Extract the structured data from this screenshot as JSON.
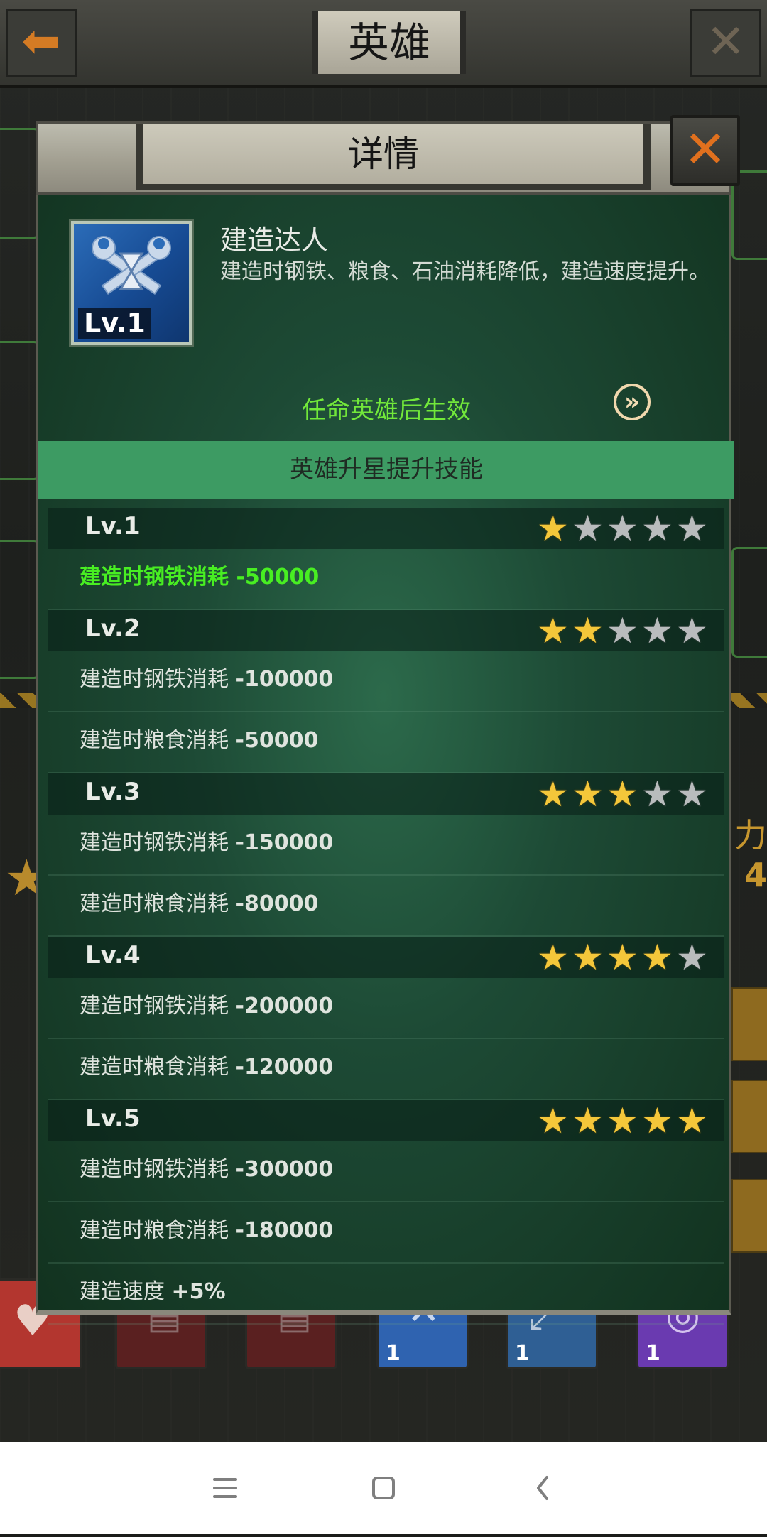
{
  "screen": {
    "title": "英雄",
    "back_icon": "arrow-left-icon",
    "close_icon": "close-icon",
    "power_label": "力",
    "power_value": "4",
    "bottom_tiles": [
      {
        "icon": "heart-icon",
        "color": "#b3362f",
        "num": ""
      },
      {
        "icon": "document-icon",
        "color": "#5a2020",
        "num": ""
      },
      {
        "icon": "document-icon",
        "color": "#5a2020",
        "num": ""
      },
      {
        "icon": "build-skill-icon",
        "color": "#2f63b0",
        "num": "1"
      },
      {
        "icon": "rifle-icon",
        "color": "#2f5f94",
        "num": "1"
      },
      {
        "icon": "target-icon",
        "color": "#6a3ab0",
        "num": "1"
      }
    ]
  },
  "dialog": {
    "title": "详情",
    "skill": {
      "name": "建造达人",
      "level": "Lv.1",
      "description": "建造时钢铁、粮食、石油消耗降低，建造速度提升。"
    },
    "appoint_text": "任命英雄后生效",
    "upgrade_header": "英雄升星提升技能",
    "levels": [
      {
        "label": "Lv.1",
        "stars": 1,
        "effects": [
          {
            "name": "建造时钢铁消耗",
            "value": "-50000",
            "active": true
          }
        ]
      },
      {
        "label": "Lv.2",
        "stars": 2,
        "effects": [
          {
            "name": "建造时钢铁消耗",
            "value": "-100000"
          },
          {
            "name": "建造时粮食消耗",
            "value": "-50000"
          }
        ]
      },
      {
        "label": "Lv.3",
        "stars": 3,
        "effects": [
          {
            "name": "建造时钢铁消耗",
            "value": "-150000"
          },
          {
            "name": "建造时粮食消耗",
            "value": "-80000"
          }
        ]
      },
      {
        "label": "Lv.4",
        "stars": 4,
        "effects": [
          {
            "name": "建造时钢铁消耗",
            "value": "-200000"
          },
          {
            "name": "建造时粮食消耗",
            "value": "-120000"
          }
        ]
      },
      {
        "label": "Lv.5",
        "stars": 5,
        "effects": [
          {
            "name": "建造时钢铁消耗",
            "value": "-300000"
          },
          {
            "name": "建造时粮食消耗",
            "value": "-180000"
          },
          {
            "name": "建造速度",
            "value": "+5%"
          }
        ]
      }
    ],
    "max_stars": 5
  },
  "navbar": {
    "menu_icon": "menu-icon",
    "home_icon": "home-icon",
    "back_icon": "back-chevron-icon"
  },
  "colors": {
    "accent_orange": "#e0701e",
    "active_green": "#48ee22",
    "appoint_green": "#72e83a",
    "upgrade_bar": "#3d9b63",
    "star_on": "#f4c73a",
    "star_off": "#b9bcbd"
  }
}
